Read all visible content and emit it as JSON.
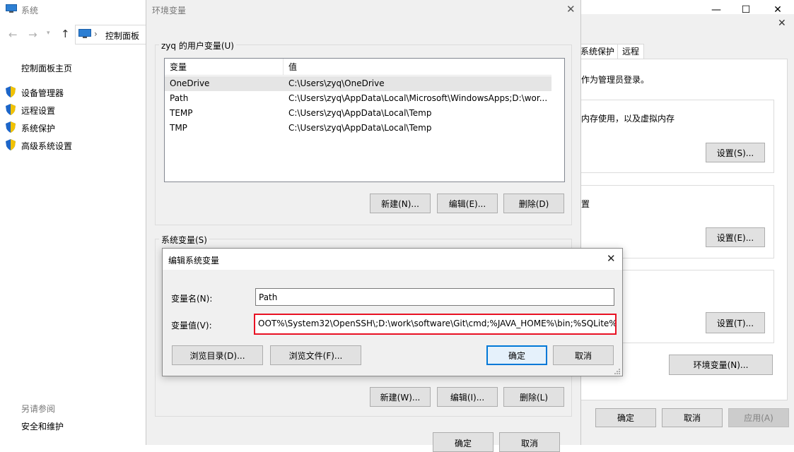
{
  "system_window": {
    "title": "系统",
    "breadcrumb_root": "控制面板",
    "left_links": [
      "控制面板主页",
      "设备管理器",
      "远程设置",
      "系统保护",
      "高级系统设置"
    ],
    "see_also_label": "另请参阅",
    "see_also_links": [
      "安全和维护"
    ]
  },
  "sys_props": {
    "tabs": [
      "系统保护",
      "远程"
    ],
    "admin_note": "作为管理员登录。",
    "perf_text": "内存使用，以及虚拟内存",
    "profile_frag": "置",
    "settings_s": "设置(S)...",
    "settings_e": "设置(E)...",
    "settings_t": "设置(T)...",
    "env_vars_button": "环境变量(N)...",
    "ok": "确定",
    "cancel": "取消",
    "apply": "应用(A)"
  },
  "env_dialog": {
    "title": "环境变量",
    "user_group_title": "zyq 的用户变量(U)",
    "columns": [
      "变量",
      "值"
    ],
    "user_vars": [
      {
        "name": "OneDrive",
        "value": "C:\\Users\\zyq\\OneDrive"
      },
      {
        "name": "Path",
        "value": "C:\\Users\\zyq\\AppData\\Local\\Microsoft\\WindowsApps;D:\\wor..."
      },
      {
        "name": "TEMP",
        "value": "C:\\Users\\zyq\\AppData\\Local\\Temp"
      },
      {
        "name": "TMP",
        "value": "C:\\Users\\zyq\\AppData\\Local\\Temp"
      }
    ],
    "user_new": "新建(N)...",
    "user_edit": "编辑(E)...",
    "user_delete": "删除(D)",
    "system_group_title": "系统变量(S)",
    "sys_new": "新建(W)...",
    "sys_edit": "编辑(I)...",
    "sys_delete": "删除(L)",
    "ok": "确定",
    "cancel": "取消"
  },
  "edit_dialog": {
    "title": "编辑系统变量",
    "name_label": "变量名(N):",
    "name_value": "Path",
    "value_label": "变量值(V):",
    "value_value": "OOT%\\System32\\OpenSSH\\;D:\\work\\software\\Git\\cmd;%JAVA_HOME%\\bin;%SQLite%;",
    "browse_dir": "浏览目录(D)...",
    "browse_file": "浏览文件(F)...",
    "ok": "确定",
    "cancel": "取消"
  },
  "colors": {
    "highlight_border": "#e81123",
    "selected_row": "#e5e5e5",
    "accent": "#0078d7"
  }
}
